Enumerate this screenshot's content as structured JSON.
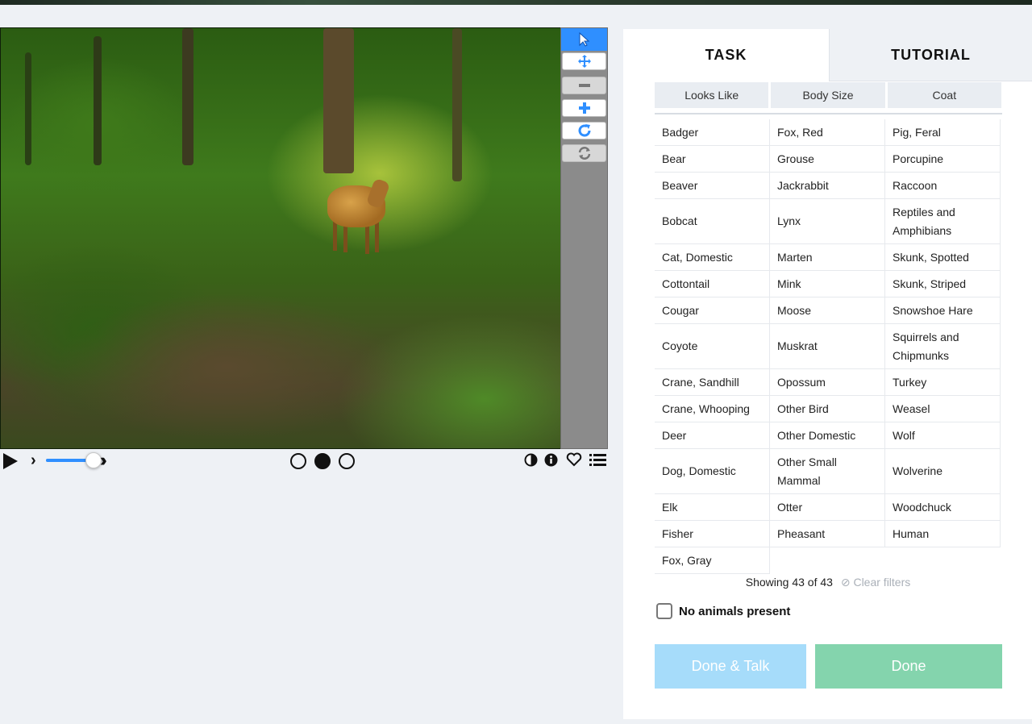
{
  "viewer": {
    "toolbar": [
      "pointer-tool",
      "move-tool",
      "zoom-out-tool",
      "zoom-in-tool",
      "rotate-tool",
      "reset-tool"
    ]
  },
  "tabs": {
    "task": "TASK",
    "tutorial": "TUTORIAL"
  },
  "filters": [
    "Looks Like",
    "Body Size",
    "Coat"
  ],
  "choices": {
    "col1": [
      {
        "label": "Badger"
      },
      {
        "label": "Bear"
      },
      {
        "label": "Beaver"
      },
      {
        "label": "Bobcat"
      },
      {
        "label": "Cat, Domestic"
      },
      {
        "label": "Cottontail"
      },
      {
        "label": "Cougar"
      },
      {
        "label": "Coyote"
      },
      {
        "label": "Crane, Sandhill"
      },
      {
        "label": "Crane, Whooping"
      },
      {
        "label": "Deer"
      },
      {
        "label": "Dog, Domestic"
      },
      {
        "label": "Elk"
      },
      {
        "label": "Fisher"
      },
      {
        "label": "Fox, Gray"
      }
    ],
    "col2": [
      {
        "label": "Fox, Red"
      },
      {
        "label": "Grouse"
      },
      {
        "label": "Jackrabbit"
      },
      {
        "label": "Lynx"
      },
      {
        "label": "Marten"
      },
      {
        "label": "Mink"
      },
      {
        "label": "Moose"
      },
      {
        "label": "Muskrat"
      },
      {
        "label": "Opossum"
      },
      {
        "label": "Other Bird"
      },
      {
        "label": "Other Domestic"
      },
      {
        "label": "Other Small Mammal"
      },
      {
        "label": "Otter"
      },
      {
        "label": "Pheasant"
      }
    ],
    "col3": [
      {
        "label": "Pig, Feral"
      },
      {
        "label": "Porcupine"
      },
      {
        "label": "Raccoon"
      },
      {
        "label": "Reptiles and Amphibians"
      },
      {
        "label": "Skunk, Spotted"
      },
      {
        "label": "Skunk, Striped"
      },
      {
        "label": "Snowshoe Hare"
      },
      {
        "label": "Squirrels and Chipmunks"
      },
      {
        "label": "Turkey"
      },
      {
        "label": "Weasel"
      },
      {
        "label": "Wolf"
      },
      {
        "label": "Wolverine"
      },
      {
        "label": "Woodchuck"
      },
      {
        "label": "Human"
      }
    ]
  },
  "showing": "Showing 43 of 43",
  "clear_filters": "Clear filters",
  "no_animals": "No animals present",
  "buttons": {
    "done_talk": "Done & Talk",
    "done": "Done"
  },
  "playback": {
    "speed_fraction": 0.8,
    "frames": 3,
    "current_frame": 2
  },
  "colors": {
    "accent": "#2f8fff",
    "done_talk": "#a6dcfa",
    "done": "#84d4ad"
  }
}
